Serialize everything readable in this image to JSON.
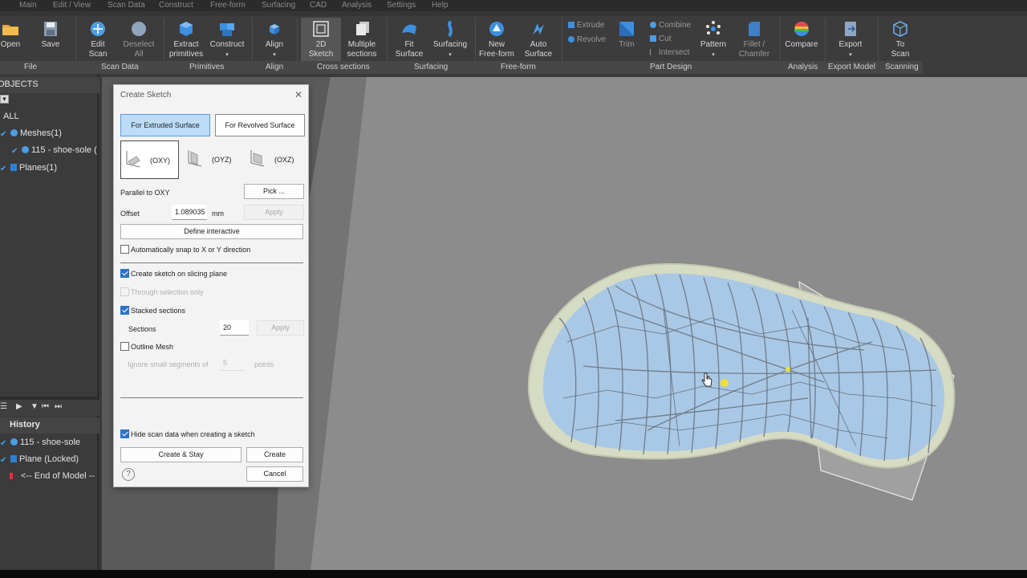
{
  "menubar": {
    "items": [
      "Main",
      "Edit / View",
      "Scan Data",
      "Construct",
      "Free-form",
      "Surfacing",
      "CAD",
      "Analysis",
      "Settings",
      "Help"
    ]
  },
  "ribbon": {
    "buttons": {
      "open": "Open",
      "save": "Save",
      "edit_scan_1": "Edit",
      "edit_scan_2": "Scan",
      "deselect_all_1": "Deselect",
      "deselect_all_2": "All",
      "extract_1": "Extract",
      "extract_2": "primitives",
      "construct": "Construct",
      "align": "Align",
      "sketch_1": "2D",
      "sketch_2": "Sketch",
      "multiple_1": "Multiple",
      "multiple_2": "sections",
      "fit_1": "Fit",
      "fit_2": "Surface",
      "surfacing": "Surfacing",
      "new_ff_1": "New",
      "new_ff_2": "Free-form",
      "auto_1": "Auto",
      "auto_2": "Surface",
      "extrude": "Extrude",
      "revolve": "Revolve",
      "trim": "Trim",
      "combine": "Combine",
      "cut": "Cut",
      "intersect": "Intersect",
      "pattern": "Pattern",
      "fillet_1": "Fillet /",
      "fillet_2": "Chamfer",
      "compare": "Compare",
      "export": "Export",
      "to_scan_1": "To",
      "to_scan_2": "Scan"
    },
    "groups": {
      "file": "File",
      "scan_data": "Scan Data",
      "primitives": "Primitives",
      "align": "Align",
      "cross_sections": "Cross sections",
      "surfacing": "Surfacing",
      "free_form": "Free-form",
      "part_design": "Part Design",
      "analysis": "Analysis",
      "export_model": "Export Model",
      "scanning": "Scanning"
    }
  },
  "objects_panel": {
    "header": "OBJECTS",
    "all": "ALL",
    "meshes": "Meshes(1)",
    "mesh_item": "115 - shoe-sole (",
    "planes": "Planes(1)"
  },
  "history_panel": {
    "header": "History",
    "items": [
      "115 - shoe-sole",
      "Plane (Locked)",
      "<-- End of Model --"
    ]
  },
  "dialog": {
    "title": "Create Sketch",
    "tab_extruded": "For Extruded Surface",
    "tab_revolved": "For Revolved Surface",
    "planes": [
      "(OXY)",
      "(OYZ)",
      "(OXZ)"
    ],
    "parallel_label": "Parallel to OXY",
    "pick": "Pick ...",
    "offset_label": "Offset",
    "offset_value": "1.089035",
    "offset_unit": "mm",
    "apply": "Apply",
    "define_interactive": "Define interactive",
    "snap_label": "Automatically snap to X or Y direction",
    "slicing_label": "Create sketch on slicing plane",
    "through_label": "Through selection only",
    "stacked_label": "Stacked sections",
    "sections_label": "Sections",
    "sections_value": "20",
    "sections_apply": "Apply",
    "outline_label": "Outline Mesh",
    "ignore_label": "Ignore small segments of",
    "ignore_value": "5",
    "points_label": "points",
    "hide_scan_label": "Hide scan data when creating a sketch",
    "create_stay": "Create & Stay",
    "create": "Create",
    "cancel": "Cancel",
    "help": "?"
  },
  "colors": {
    "ribbon_bg": "#3c3c3c",
    "panel_bg": "#3b3b3b",
    "viewport_bg": "#8c8c8c",
    "accent_blue": "#2e72c7",
    "selected_tab": "#bcdcf8",
    "sole_fill": "#a9c8e6",
    "sole_outline": "#d8ddc4"
  }
}
